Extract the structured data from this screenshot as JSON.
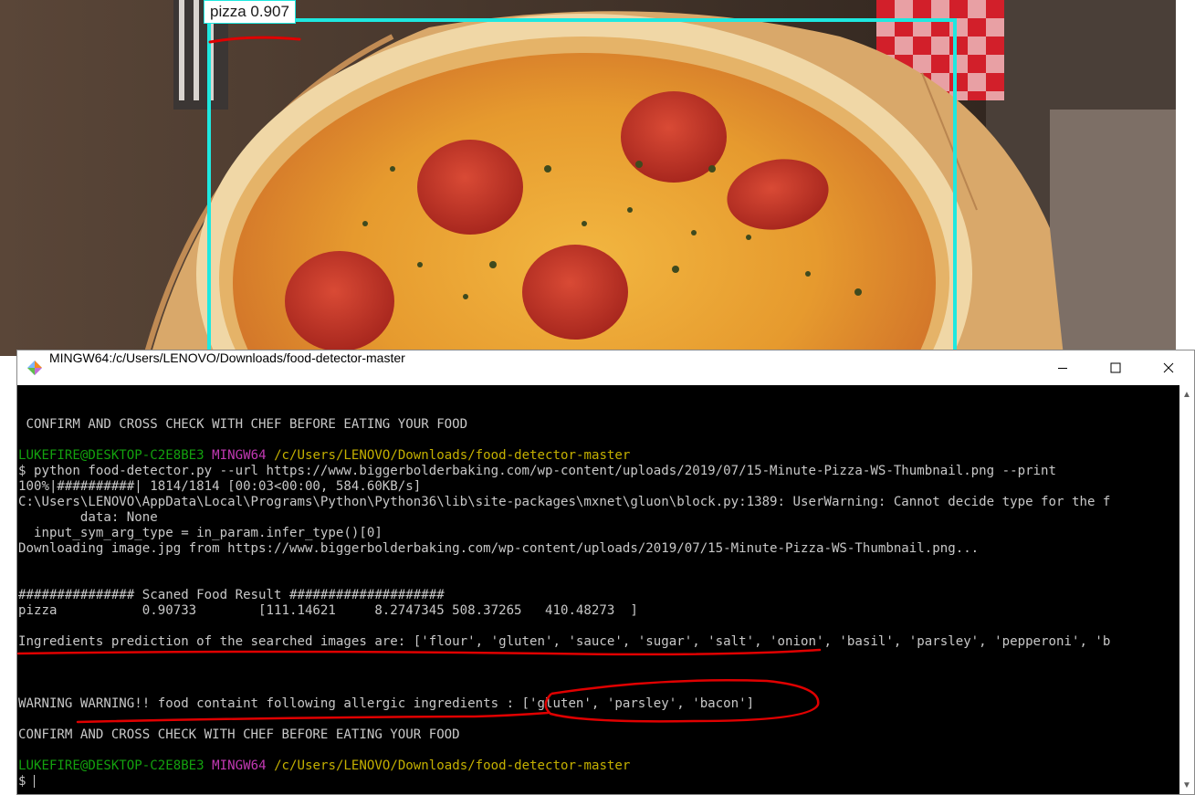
{
  "detection": {
    "label": "pizza 0.907",
    "box_color": "#1ee8e0"
  },
  "window": {
    "title": "MINGW64:/c/Users/LENOVO/Downloads/food-detector-master",
    "minimize_icon": "minimize-icon",
    "maximize_icon": "maximize-icon",
    "close_icon": "close-icon"
  },
  "console": {
    "line_confirm_top": " CONFIRM AND CROSS CHECK WITH CHEF BEFORE EATING YOUR FOOD",
    "prompt1": {
      "user": "LUKEFIRE@DESKTOP-C2E8BE3",
      "shell": "MINGW64",
      "path": "/c/Users/LENOVO/Downloads/food-detector-master"
    },
    "command": "$ python food-detector.py --url https://www.biggerbolderbaking.com/wp-content/uploads/2019/07/15-Minute-Pizza-WS-Thumbnail.png --print",
    "progress": "100%|##########| 1814/1814 [00:03<00:00, 584.60KB/s]",
    "warning_line1": "C:\\Users\\LENOVO\\AppData\\Local\\Programs\\Python\\Python36\\lib\\site-packages\\mxnet\\gluon\\block.py:1389: UserWarning: Cannot decide type for the f",
    "warning_line2": "        data: None",
    "warning_line3": "  input_sym_arg_type = in_param.infer_type()[0]",
    "downloading": "Downloading image.jpg from https://www.biggerbolderbaking.com/wp-content/uploads/2019/07/15-Minute-Pizza-WS-Thumbnail.png...",
    "result_header": "############### Scaned Food Result ####################",
    "result_row": "pizza           0.90733        [111.14621     8.2747345 508.37265   410.48273  ]",
    "ingredients": "Ingredients prediction of the searched images are: ['flour', 'gluten', 'sauce', 'sugar', 'salt', 'onion', 'basil', 'parsley', 'pepperoni', 'b",
    "warning": "WARNING WARNING!! food containt following allergic ingredients : ['gluten', 'parsley', 'bacon']",
    "line_confirm_bottom": "CONFIRM AND CROSS CHECK WITH CHEF BEFORE EATING YOUR FOOD",
    "prompt2": {
      "user": "LUKEFIRE@DESKTOP-C2E8BE3",
      "shell": "MINGW64",
      "path": "/c/Users/LENOVO/Downloads/food-detector-master"
    },
    "input_prompt": "$ "
  },
  "colors": {
    "prompt_user": "#13a10e",
    "prompt_shell": "#c239b3",
    "prompt_path": "#c4b000",
    "annotation": "#e00000"
  }
}
